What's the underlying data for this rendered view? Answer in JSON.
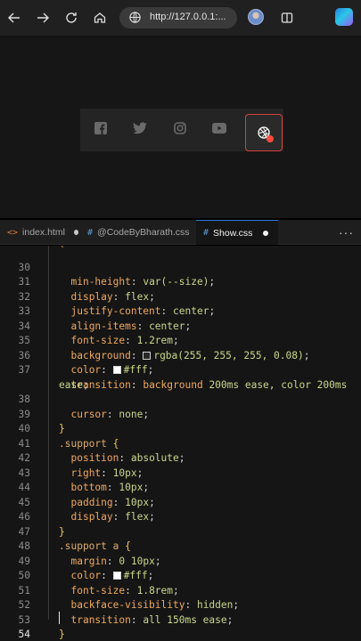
{
  "browser": {
    "url": "http://127.0.0.1:...",
    "icons": [
      "back-icon",
      "forward-icon",
      "refresh-icon",
      "home-icon",
      "globe-icon",
      "profile-avatar",
      "split-screen-icon",
      "copilot-icon"
    ]
  },
  "preview": {
    "social_icons": [
      "facebook-icon",
      "twitter-icon",
      "instagram-icon",
      "youtube-icon",
      "dribbble-icon"
    ],
    "active_icon": "dribbble-icon",
    "accent_color": "#d3423a"
  },
  "editor": {
    "tabs": [
      {
        "icon": "<>",
        "label": "index.html",
        "modified": true
      },
      {
        "icon": "#",
        "label": "@CodeByBharath.css",
        "modified": true
      },
      {
        "icon": "#",
        "label": "Show.css",
        "modified": true,
        "active": true
      }
    ],
    "more_label": "···",
    "partial_line": "(",
    "lines": [
      {
        "n": "30"
      },
      {
        "n": "31"
      },
      {
        "n": "32"
      },
      {
        "n": "33"
      },
      {
        "n": "34"
      },
      {
        "n": "35"
      },
      {
        "n": "36"
      },
      {
        "n": "37"
      },
      {
        "n": "38"
      },
      {
        "n": "39"
      },
      {
        "n": "40"
      },
      {
        "n": "41"
      },
      {
        "n": "42"
      },
      {
        "n": "43"
      },
      {
        "n": "44"
      },
      {
        "n": "45"
      },
      {
        "n": "46"
      },
      {
        "n": "47"
      },
      {
        "n": "48"
      },
      {
        "n": "49"
      },
      {
        "n": "50"
      },
      {
        "n": "51"
      },
      {
        "n": "52"
      },
      {
        "n": "53"
      },
      {
        "n": "54"
      }
    ],
    "code": {
      "l30_prop": "min-height",
      "l30_val": "var(--size)",
      "l31_prop": "display",
      "l31_val": "flex",
      "l32_prop": "justify-content",
      "l32_val": "center",
      "l33_prop": "align-items",
      "l33_val": "center",
      "l34_prop": "font-size",
      "l34_val": "1.2rem",
      "l35_prop": "background",
      "l35_val": "rgba(255, 255, 255, 0.08)",
      "l36_prop": "color",
      "l36_val": "#fff",
      "l37_prop": "transition",
      "l37_val1": "background",
      "l37_val2": "200ms ease, color 200ms",
      "l37_cont": "ease",
      "l38_prop": "cursor",
      "l38_val": "none",
      "l39": "}",
      "l40_sel": ".support",
      "l40_brace": "{",
      "l41_prop": "position",
      "l41_val": "absolute",
      "l42_prop": "right",
      "l42_val": "10px",
      "l43_prop": "bottom",
      "l43_val": "10px",
      "l44_prop": "padding",
      "l44_val": "10px",
      "l45_prop": "display",
      "l45_val": "flex",
      "l46": "}",
      "l47_sel": ".support a",
      "l47_brace": "{",
      "l48_prop": "margin",
      "l48_val": "0 10px",
      "l49_prop": "color",
      "l49_val": "#fff",
      "l50_prop": "font-size",
      "l50_val": "1.8rem",
      "l51_prop": "backface-visibility",
      "l51_val": "hidden",
      "l52_prop": "transition",
      "l52_val": "all 150ms ease",
      "l53": "}"
    }
  }
}
